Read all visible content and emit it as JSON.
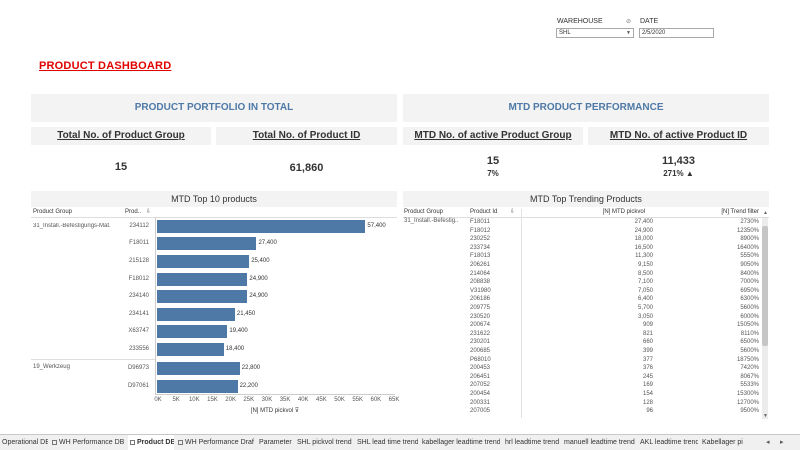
{
  "filters": {
    "warehouse_label": "WAREHOUSE",
    "warehouse_value": "SHL",
    "date_label": "DATE",
    "date_value": "2/5/2020"
  },
  "dashboard_title": "PRODUCT DASHBOARD",
  "portfolio": {
    "title": "PRODUCT PORTFOLIO IN TOTAL",
    "group_head": "Total No. of Product Group",
    "group_value": "15",
    "id_head": "Total No. of Product ID",
    "id_value": "61,860"
  },
  "mtd": {
    "title": "MTD PRODUCT PERFORMANCE",
    "group_head": "MTD No. of active Product Group",
    "group_value": "15",
    "group_pct": "7%",
    "id_head": "MTD  No. of active Product ID",
    "id_value": "11,433",
    "id_pct": "271% ▲"
  },
  "top10": {
    "title": "MTD Top 10 products",
    "col_group": "Product Group",
    "col_prod": "Prod..",
    "groups": [
      "31_Install.-Befestigungs-Mat.",
      "19_Werkzeug"
    ],
    "x_axis_label": "[N] MTD pickvol",
    "ticks": [
      "0K",
      "5K",
      "10K",
      "15K",
      "20K",
      "25K",
      "30K",
      "35K",
      "40K",
      "45K",
      "50K",
      "55K",
      "60K",
      "65K"
    ]
  },
  "chart_data": {
    "type": "bar",
    "orientation": "horizontal",
    "title": "MTD Top 10 products",
    "xlabel": "[N] MTD pickvol",
    "xlim": [
      0,
      65000
    ],
    "categories": [
      "234112",
      "F18011",
      "215128",
      "F18012",
      "234140",
      "234141",
      "X63747",
      "233556",
      "D96973",
      "D97061"
    ],
    "values": [
      57400,
      27400,
      25400,
      24900,
      24900,
      21450,
      19400,
      18400,
      22800,
      22200
    ],
    "value_labels": [
      "57,400",
      "27,400",
      "25,400",
      "24,900",
      "24,900",
      "21,450",
      "19,400",
      "18,400",
      "22,800",
      "22,200"
    ],
    "group_of": [
      "31_Install.-Befestigungs-Mat.",
      "31_Install.-Befestigungs-Mat.",
      "31_Install.-Befestigungs-Mat.",
      "31_Install.-Befestigungs-Mat.",
      "31_Install.-Befestigungs-Mat.",
      "31_Install.-Befestigungs-Mat.",
      "31_Install.-Befestigungs-Mat.",
      "31_Install.-Befestigungs-Mat.",
      "19_Werkzeug",
      "19_Werkzeug"
    ]
  },
  "trending": {
    "title": "MTD Top Trending Products",
    "col_group": "Product Group",
    "col_id": "Product Id",
    "col_pickvol": "[N] MTD pickvol",
    "col_trend": "[N] Trend filter",
    "group": "31_Install.-Befestig..",
    "rows": [
      [
        "F18011",
        "27,400",
        "2730%"
      ],
      [
        "F18012",
        "24,900",
        "12350%"
      ],
      [
        "230252",
        "18,000",
        "8900%"
      ],
      [
        "233734",
        "16,500",
        "16400%"
      ],
      [
        "F18013",
        "11,300",
        "5550%"
      ],
      [
        "206261",
        "9,150",
        "9050%"
      ],
      [
        "214064",
        "8,500",
        "8400%"
      ],
      [
        "208838",
        "7,100",
        "7000%"
      ],
      [
        "V31980",
        "7,050",
        "6950%"
      ],
      [
        "206186",
        "6,400",
        "6300%"
      ],
      [
        "209775",
        "5,700",
        "5600%"
      ],
      [
        "230520",
        "3,050",
        "6000%"
      ],
      [
        "200674",
        "909",
        "15050%"
      ],
      [
        "231622",
        "821",
        "8110%"
      ],
      [
        "230201",
        "660",
        "6500%"
      ],
      [
        "200685",
        "399",
        "5600%"
      ],
      [
        "P68010",
        "377",
        "18750%"
      ],
      [
        "200453",
        "376",
        "7420%"
      ],
      [
        "206451",
        "245",
        "8067%"
      ],
      [
        "207052",
        "169",
        "5533%"
      ],
      [
        "200454",
        "154",
        "15300%"
      ],
      [
        "200331",
        "128",
        "12700%"
      ],
      [
        "207005",
        "96",
        "9500%"
      ]
    ]
  },
  "tabs": [
    {
      "label": "Operational DB",
      "active": false
    },
    {
      "label": "WH Performance DB",
      "active": false
    },
    {
      "label": "Product DB",
      "active": true
    },
    {
      "label": "WH Performance Draft",
      "active": false
    },
    {
      "label": "Parameter",
      "active": false
    },
    {
      "label": "SHL pickvol trend",
      "active": false
    },
    {
      "label": "SHL lead time trend",
      "active": false
    },
    {
      "label": "kabellager leadtime trend",
      "active": false
    },
    {
      "label": "hrl leadtime trend",
      "active": false
    },
    {
      "label": "manuell leadtime trend",
      "active": false
    },
    {
      "label": "AKL leadtime trend",
      "active": false
    },
    {
      "label": "Kabellager pi",
      "active": false
    }
  ],
  "colors": {
    "accent": "#4e79a7",
    "title_red": "#e00000",
    "band_gray": "#f3f3f3"
  }
}
